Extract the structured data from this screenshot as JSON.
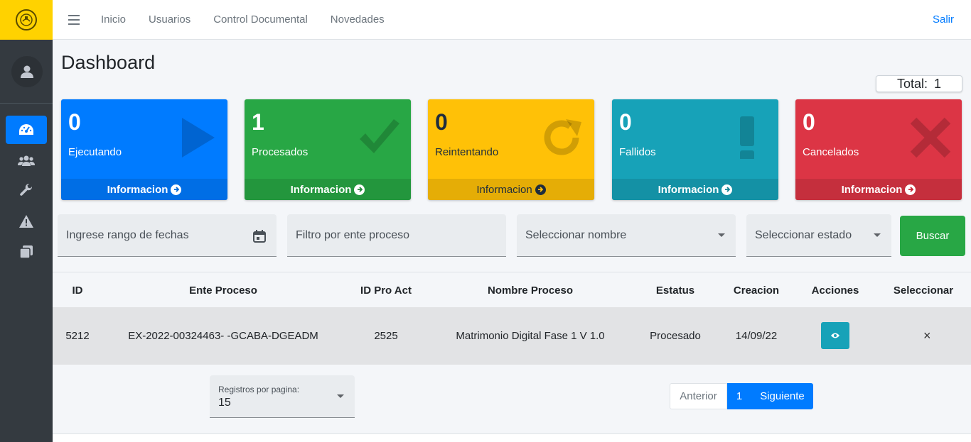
{
  "nav": {
    "links": [
      "Inicio",
      "Usuarios",
      "Control Documental",
      "Novedades"
    ],
    "logout": "Salir"
  },
  "sidebar": {
    "items": [
      {
        "icon": "dashboard-icon",
        "active": true
      },
      {
        "icon": "users-icon",
        "active": false
      },
      {
        "icon": "wrench-icon",
        "active": false
      },
      {
        "icon": "warning-icon",
        "active": false
      },
      {
        "icon": "copy-icon",
        "active": false
      }
    ]
  },
  "page": {
    "title": "Dashboard",
    "total_label": "Total:",
    "total_value": "1"
  },
  "cards": [
    {
      "count": "0",
      "label": "Ejecutando",
      "footer": "Informacion",
      "color": "#007bff",
      "icon": "play-icon"
    },
    {
      "count": "1",
      "label": "Procesados",
      "footer": "Informacion",
      "color": "#28a745",
      "icon": "check-icon"
    },
    {
      "count": "0",
      "label": "Reintentando",
      "footer": "Informacion",
      "color": "#ffc107",
      "icon": "redo-icon"
    },
    {
      "count": "0",
      "label": "Fallidos",
      "footer": "Informacion",
      "color": "#17a2b8",
      "icon": "exclamation-icon"
    },
    {
      "count": "0",
      "label": "Cancelados",
      "footer": "Informacion",
      "color": "#dc3545",
      "icon": "times-icon"
    }
  ],
  "filters": {
    "date_range": "Ingrese rango de fechas",
    "ente_proceso": "Filtro por ente proceso",
    "nombre": "Seleccionar nombre",
    "estado": "Seleccionar estado",
    "search_button": "Buscar"
  },
  "table": {
    "headers": [
      "ID",
      "Ente Proceso",
      "ID Pro Act",
      "Nombre Proceso",
      "Estatus",
      "Creacion",
      "Acciones",
      "Seleccionar"
    ],
    "rows": [
      {
        "id": "5212",
        "ente": "EX-2022-00324463- -GCABA-DGEADM",
        "id_pro_act": "2525",
        "nombre": "Matrimonio Digital Fase 1 V 1.0",
        "estatus": "Procesado",
        "creacion": "14/09/22",
        "select": "×"
      }
    ]
  },
  "pagination": {
    "per_page_label": "Registros por pagina:",
    "per_page_value": "15",
    "prev": "Anterior",
    "current": "1",
    "next": "Siguiente"
  }
}
